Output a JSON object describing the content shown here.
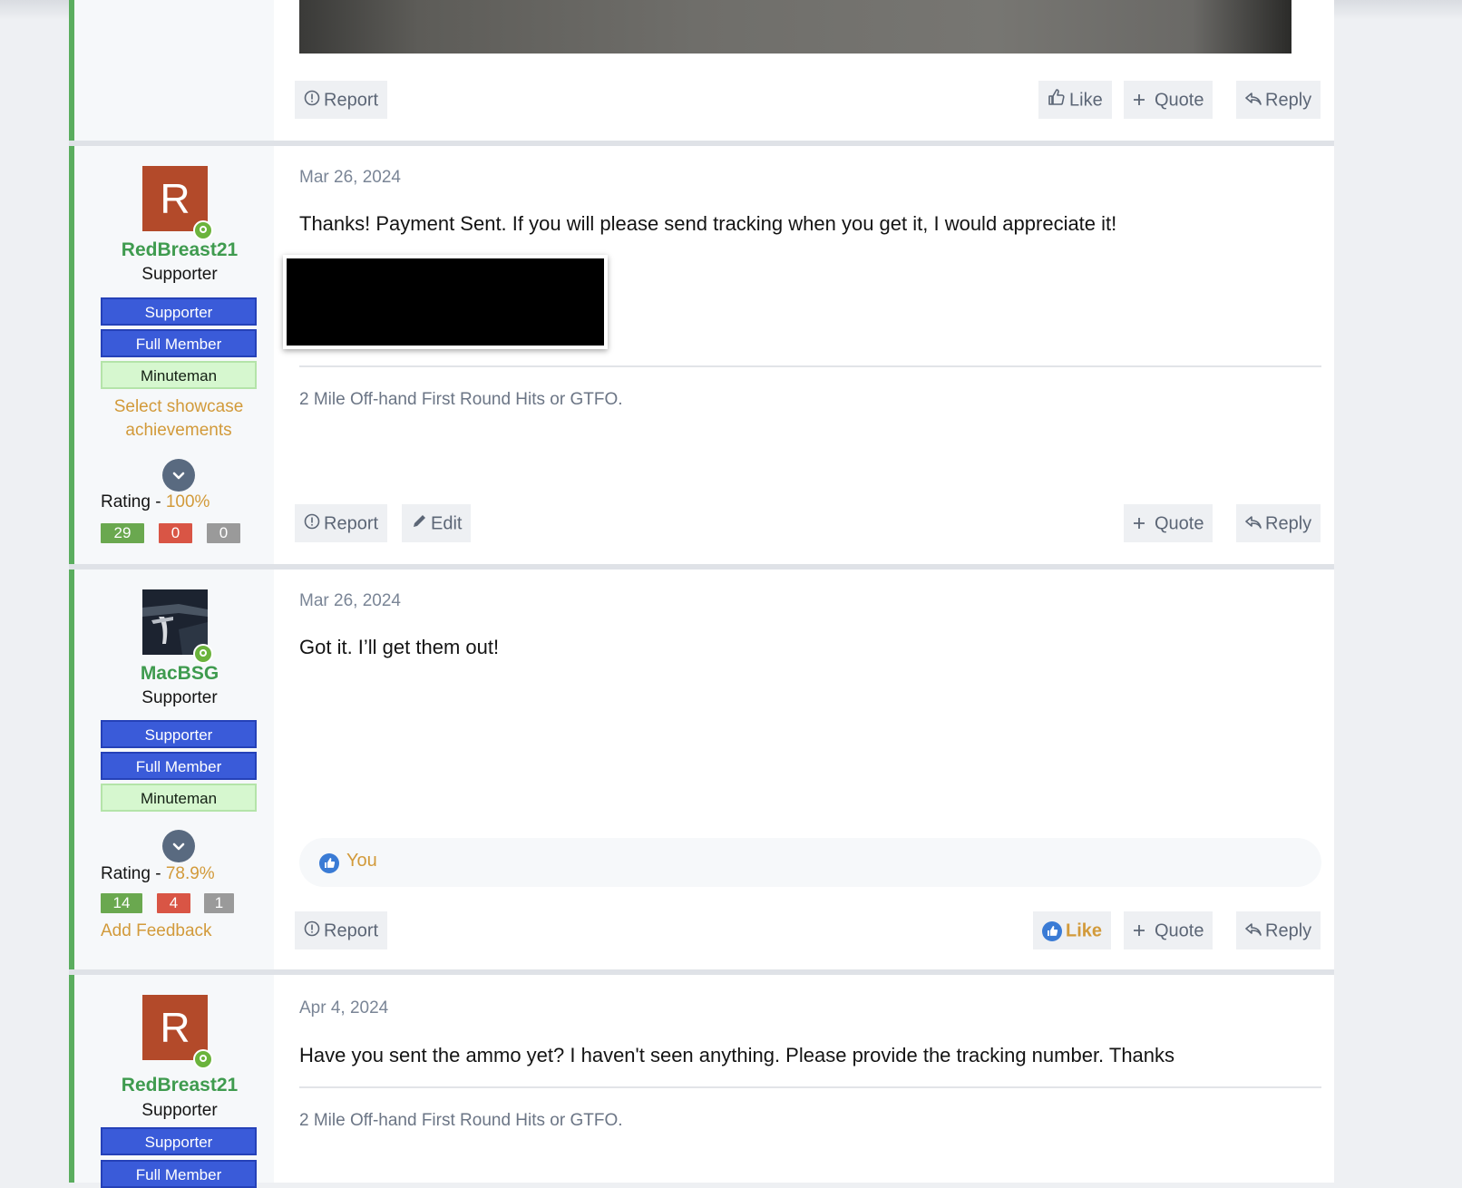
{
  "post0": {
    "buttons": {
      "report": "Report",
      "like": "Like",
      "quote": "Quote",
      "reply": "Reply"
    }
  },
  "post1": {
    "avatar_letter": "R",
    "username": "RedBreast21",
    "user_title": "Supporter",
    "banners": [
      "Supporter",
      "Full Member",
      "Minuteman"
    ],
    "showcase": "Select showcase achievements",
    "rating_label": "Rating - ",
    "rating_value": "100%",
    "feedback": {
      "positive": "29",
      "negative": "0",
      "neutral": "0"
    },
    "date": "Mar 26, 2024",
    "message": "Thanks! Payment Sent. If you will please send tracking when you get it, I would appreciate it!",
    "signature": "2 Mile Off-hand First Round Hits or GTFO.",
    "buttons": {
      "report": "Report",
      "edit": "Edit",
      "quote": "Quote",
      "reply": "Reply"
    }
  },
  "post2": {
    "username": "MacBSG",
    "user_title": "Supporter",
    "banners": [
      "Supporter",
      "Full Member",
      "Minuteman"
    ],
    "rating_label": "Rating - ",
    "rating_value": "78.9%",
    "feedback": {
      "positive": "14",
      "negative": "4",
      "neutral": "1"
    },
    "add_feedback": "Add Feedback",
    "date": "Mar 26, 2024",
    "message": "Got it. I’ll get them out!",
    "reactions": "You",
    "buttons": {
      "report": "Report",
      "like": "Like",
      "quote": "Quote",
      "reply": "Reply"
    }
  },
  "post3": {
    "avatar_letter": "R",
    "username": "RedBreast21",
    "user_title": "Supporter",
    "banners": [
      "Supporter",
      "Full Member"
    ],
    "date": "Apr 4, 2024",
    "message": "Have you sent the ammo yet? I haven't seen anything. Please provide the tracking number. Thanks",
    "signature": "2 Mile Off-hand First Round Hits or GTFO."
  },
  "colors": {
    "accent": "#d29a3a",
    "username": "#3f9b4f",
    "online": "#6bb33c",
    "banner_blue": "#3a5bd9",
    "banner_green": "#d6f7cf",
    "post_border": "#5aad5e"
  }
}
